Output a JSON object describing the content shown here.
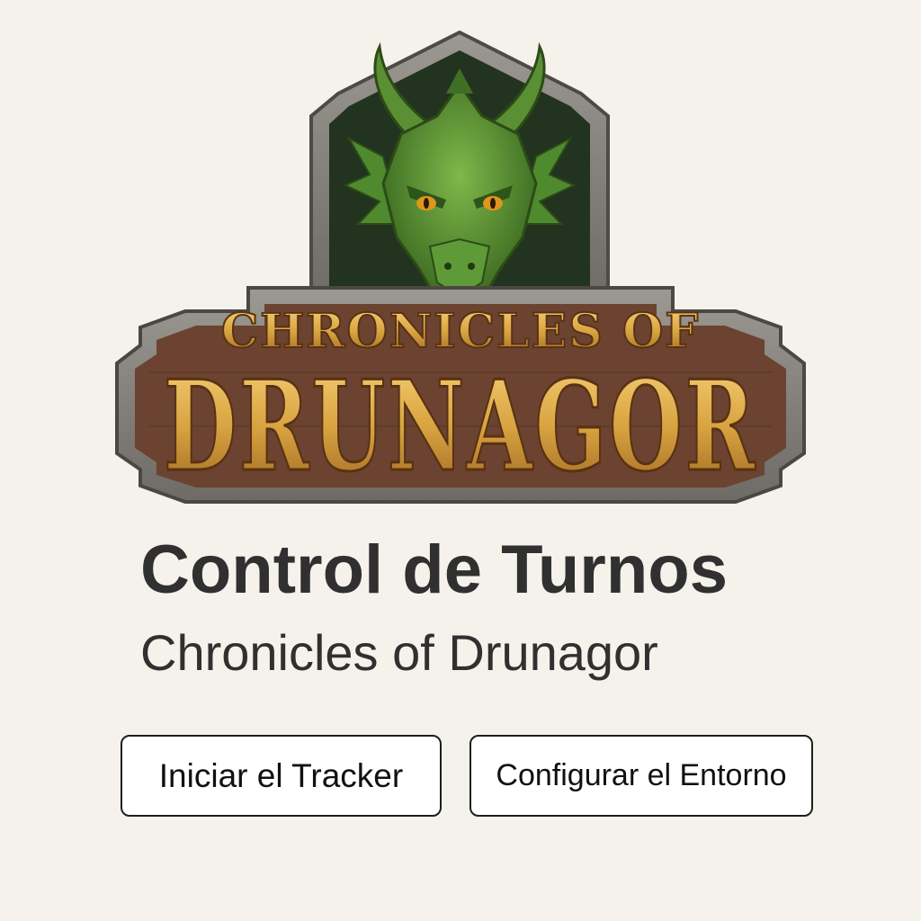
{
  "logo": {
    "line1": "CHRONICLES OF",
    "line2": "DRUNAGOR"
  },
  "header": {
    "title": "Control de Turnos",
    "subtitle": "Chronicles of Drunagor"
  },
  "actions": {
    "start_label": "Iniciar el Tracker",
    "config_label": "Configurar el Entorno"
  },
  "colors": {
    "background": "#f5f2ec",
    "text": "#303030",
    "logo_gold": "#d9a441",
    "logo_wood": "#6b4330",
    "logo_stone": "#8a8580",
    "dragon_green": "#4f8a2e",
    "dragon_eye": "#e0951c"
  },
  "icons": {
    "logo_emblem": "dragon-head-icon"
  }
}
